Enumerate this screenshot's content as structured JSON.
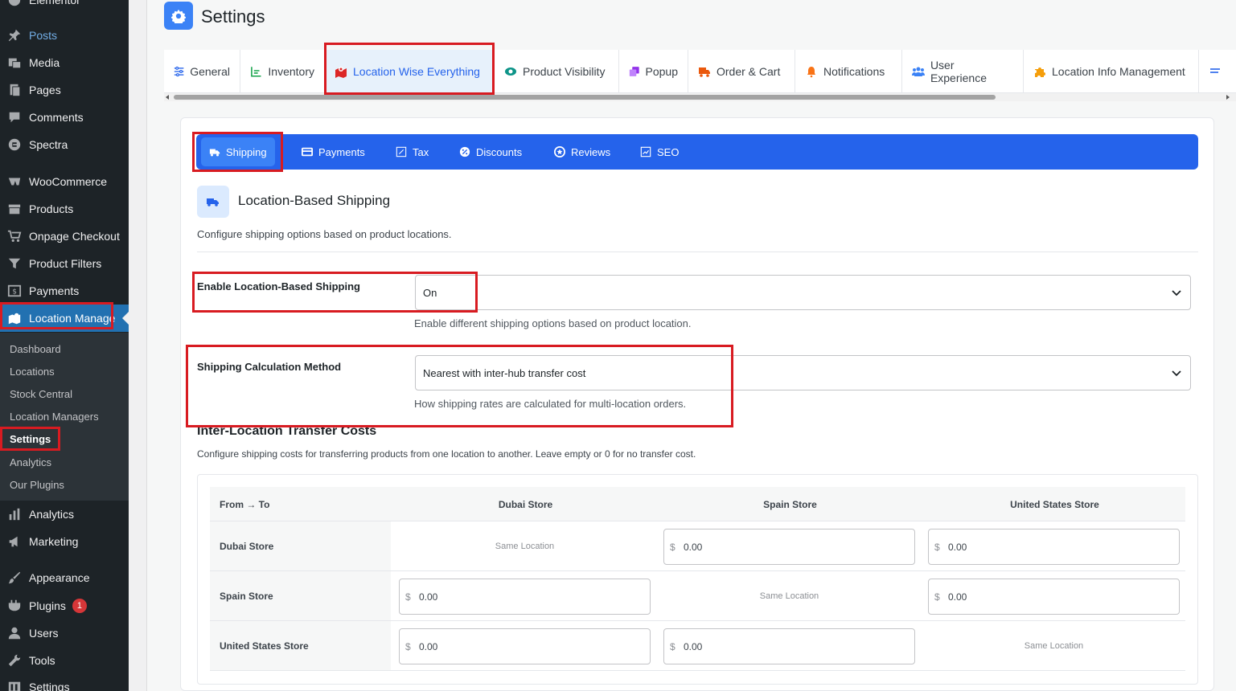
{
  "sidebar": {
    "items": [
      {
        "label": "Elementor",
        "icon": "elementor-icon"
      },
      {
        "label": "Posts",
        "icon": "pin-icon"
      },
      {
        "label": "Media",
        "icon": "media-icon"
      },
      {
        "label": "Pages",
        "icon": "pages-icon"
      },
      {
        "label": "Comments",
        "icon": "comment-icon"
      },
      {
        "label": "Spectra",
        "icon": "spectra-icon"
      },
      {
        "label": "WooCommerce",
        "icon": "woocommerce-icon"
      },
      {
        "label": "Products",
        "icon": "archive-icon"
      },
      {
        "label": "Onpage Checkout",
        "icon": "cart-icon"
      },
      {
        "label": "Product Filters",
        "icon": "filter-icon"
      },
      {
        "label": "Payments",
        "icon": "payment-icon"
      },
      {
        "label": "Location Manage",
        "icon": "map-icon"
      },
      {
        "label": "Analytics",
        "icon": "chart-icon"
      },
      {
        "label": "Marketing",
        "icon": "megaphone-icon"
      },
      {
        "label": "Appearance",
        "icon": "brush-icon"
      },
      {
        "label": "Plugins",
        "icon": "plugin-icon",
        "badge": "1"
      },
      {
        "label": "Users",
        "icon": "user-icon"
      },
      {
        "label": "Tools",
        "icon": "wrench-icon"
      },
      {
        "label": "Settings",
        "icon": "settings-icon"
      }
    ],
    "submenu": [
      "Dashboard",
      "Locations",
      "Stock Central",
      "Location Managers",
      "Settings",
      "Analytics",
      "Our Plugins"
    ]
  },
  "header": {
    "title": "Settings"
  },
  "tabs": [
    {
      "label": "General",
      "icon": "sliders-icon"
    },
    {
      "label": "Inventory",
      "icon": "chart-line-icon"
    },
    {
      "label": "Location Wise Everything",
      "icon": "map-marked-icon"
    },
    {
      "label": "Product Visibility",
      "icon": "eye-icon"
    },
    {
      "label": "Popup",
      "icon": "clone-icon"
    },
    {
      "label": "Order & Cart",
      "icon": "truck-icon"
    },
    {
      "label": "Notifications",
      "icon": "bell-icon"
    },
    {
      "label": "User Experience",
      "icon": "users-icon"
    },
    {
      "label": "Location Info Management",
      "icon": "puzzle-icon"
    }
  ],
  "subtabs": [
    {
      "label": "Shipping",
      "icon": "shipping-icon"
    },
    {
      "label": "Payments",
      "icon": "credit-card-icon"
    },
    {
      "label": "Tax",
      "icon": "percent-icon"
    },
    {
      "label": "Discounts",
      "icon": "discount-icon"
    },
    {
      "label": "Reviews",
      "icon": "star-icon"
    },
    {
      "label": "SEO",
      "icon": "seo-chart-icon"
    }
  ],
  "section": {
    "title": "Location-Based Shipping",
    "description": "Configure shipping options based on product locations."
  },
  "fields": {
    "enable": {
      "label": "Enable Location-Based Shipping",
      "value": "On",
      "help": "Enable different shipping options based on product location."
    },
    "method": {
      "label": "Shipping Calculation Method",
      "value": "Nearest with inter-hub transfer cost",
      "help": "How shipping rates are calculated for multi-location orders."
    }
  },
  "transfer": {
    "title": "Inter-Location Transfer Costs",
    "description": "Configure shipping costs for transferring products from one location to another. Leave empty or 0 for no transfer cost.",
    "headers": [
      "From → To",
      "Dubai Store",
      "Spain Store",
      "United States Store"
    ],
    "currency": "$",
    "same_label": "Same Location",
    "rows": [
      {
        "label": "Dubai Store",
        "cells": [
          "same",
          "0.00",
          "0.00"
        ]
      },
      {
        "label": "Spain Store",
        "cells": [
          "0.00",
          "same",
          "0.00"
        ]
      },
      {
        "label": "United States Store",
        "cells": [
          "0.00",
          "0.00",
          "same"
        ]
      }
    ]
  },
  "colors": {
    "accent": "#2563eb",
    "highlight_box": "#d81b21",
    "wp_sidebar": "#1d2327"
  }
}
